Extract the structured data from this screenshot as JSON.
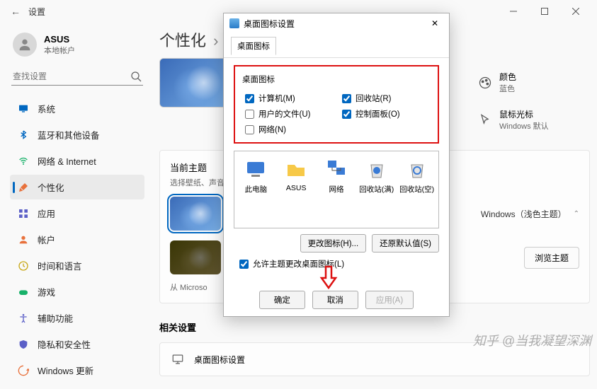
{
  "window": {
    "title": "设置"
  },
  "user": {
    "name": "ASUS",
    "sub": "本地帐户"
  },
  "search": {
    "placeholder": "查找设置"
  },
  "nav": [
    {
      "label": "系统",
      "icon": "monitor",
      "color": "#0067c0"
    },
    {
      "label": "蓝牙和其他设备",
      "icon": "bluetooth",
      "color": "#0067c0"
    },
    {
      "label": "网络 & Internet",
      "icon": "wifi",
      "color": "#17b169"
    },
    {
      "label": "个性化",
      "icon": "brush",
      "color": "#e8713c",
      "active": true
    },
    {
      "label": "应用",
      "icon": "apps",
      "color": "#5b5fc7"
    },
    {
      "label": "帐户",
      "icon": "person",
      "color": "#e8713c"
    },
    {
      "label": "时间和语言",
      "icon": "clock",
      "color": "#c8a818"
    },
    {
      "label": "游戏",
      "icon": "game",
      "color": "#17b169"
    },
    {
      "label": "辅助功能",
      "icon": "access",
      "color": "#5b5fc7"
    },
    {
      "label": "隐私和安全性",
      "icon": "shield",
      "color": "#5b5fc7"
    },
    {
      "label": "Windows 更新",
      "icon": "update",
      "color": "#e8713c"
    }
  ],
  "breadcrumb": {
    "root": "个性化"
  },
  "right_options": [
    {
      "title": "颜色",
      "sub": "蓝色",
      "icon": "palette"
    },
    {
      "title": "鼠标光标",
      "sub": "Windows 默认",
      "icon": "cursor"
    }
  ],
  "theme_panel": {
    "title": "当前主题",
    "sub": "选择壁纸、声音和颜",
    "mode_label": "Windows（浅色主题）",
    "browse": "浏览主题",
    "source_prefix": "从 Microso"
  },
  "related": {
    "heading": "相关设置",
    "row1": "桌面图标设置"
  },
  "dialog": {
    "title": "桌面图标设置",
    "tab": "桌面图标",
    "group": "桌面图标",
    "checks": {
      "computer": {
        "label": "计算机(M)",
        "checked": true
      },
      "recycle": {
        "label": "回收站(R)",
        "checked": true
      },
      "userfiles": {
        "label": "用户的文件(U)",
        "checked": false
      },
      "control": {
        "label": "控制面板(O)",
        "checked": true
      },
      "network": {
        "label": "网络(N)",
        "checked": false
      }
    },
    "icons": [
      {
        "label": "此电脑",
        "kind": "pc"
      },
      {
        "label": "ASUS",
        "kind": "folder"
      },
      {
        "label": "网络",
        "kind": "net"
      },
      {
        "label": "回收站(满)",
        "kind": "binf"
      },
      {
        "label": "回收站(空)",
        "kind": "bine"
      }
    ],
    "change_icon": "更改图标(H)...",
    "restore_default": "还原默认值(S)",
    "allow_theme": "允许主题更改桌面图标(L)",
    "ok": "确定",
    "cancel": "取消",
    "apply": "应用(A)"
  },
  "watermark": "知乎 @当我凝望深渊"
}
